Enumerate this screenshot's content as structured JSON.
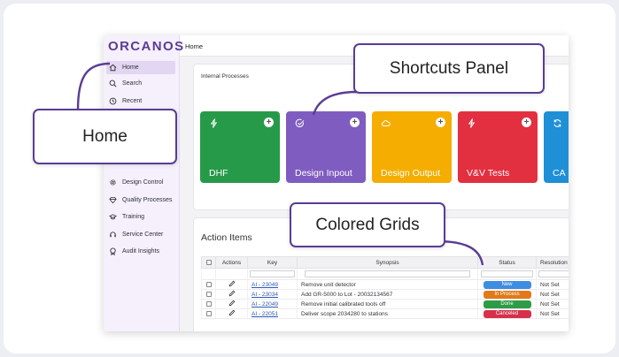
{
  "app": {
    "logo": "ORCANOS",
    "page_title": "Home"
  },
  "sidebar": {
    "items": [
      {
        "label": "Home",
        "icon": "home-icon",
        "active": true
      },
      {
        "label": "Search",
        "icon": "search-icon"
      },
      {
        "label": "Recent",
        "icon": "history-icon"
      },
      {
        "label": "Design Control",
        "icon": "gear-icon"
      },
      {
        "label": "Quality Processes",
        "icon": "diamond-icon"
      },
      {
        "label": "Training",
        "icon": "graduation-cap-icon"
      },
      {
        "label": "Service Center",
        "icon": "headset-icon"
      },
      {
        "label": "Audit Insights",
        "icon": "audit-badge-icon"
      }
    ]
  },
  "internal_processes": {
    "title": "Internal Processes",
    "tiles": [
      {
        "label": "DHF",
        "color": "#279a4a",
        "icon": "bolt-icon"
      },
      {
        "label": "Design Inpout",
        "color": "#7f5cc0",
        "icon": "check-circle-icon"
      },
      {
        "label": "Design Output",
        "color": "#f4ad00",
        "icon": "cloud-icon"
      },
      {
        "label": "V&V Tests",
        "color": "#e23041",
        "icon": "bolt-icon"
      },
      {
        "label": "CA",
        "color": "#1f8fd6",
        "icon": "sync-icon"
      }
    ]
  },
  "action_items": {
    "title": "Action Items",
    "columns": [
      "",
      "Actions",
      "Key",
      "Synopsis",
      "Status",
      "Resolution"
    ],
    "rows": [
      {
        "key": "AI - 23049",
        "synopsis": "Remove unit detector",
        "status": "New",
        "status_color": "#3f8de0",
        "resolution": "Not Set"
      },
      {
        "key": "AI - 23034",
        "synopsis": "Add GR-5000 to Lot - 20032134567",
        "status": "In Process",
        "status_color": "#e07a1a",
        "resolution": "Not Set"
      },
      {
        "key": "AI - 22049",
        "synopsis": "Remove initial calibrated tools off",
        "status": "Done",
        "status_color": "#2e9b47",
        "resolution": "Not Set"
      },
      {
        "key": "AI - 22051",
        "synopsis": "Deliver scope 2034280 to stations",
        "status": "Canceled",
        "status_color": "#d6304a",
        "resolution": "Not Set"
      }
    ]
  },
  "callouts": {
    "home": "Home",
    "shortcuts": "Shortcuts Panel",
    "grids": "Colored Grids"
  },
  "colors": {
    "brand": "#5b3c94",
    "sidebar_bg": "#f5f0fb",
    "active_nav": "#e2d6f2"
  }
}
